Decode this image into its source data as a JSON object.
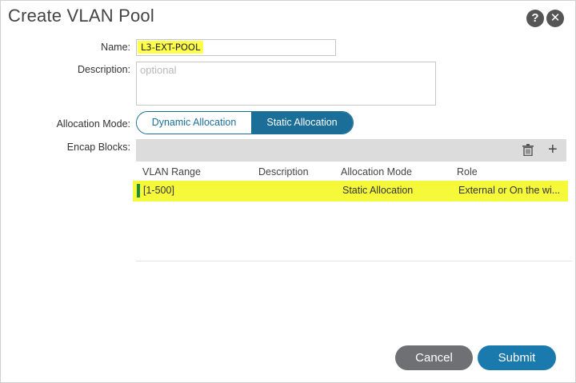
{
  "dialog": {
    "title": "Create VLAN Pool",
    "help_icon": "?",
    "close_icon": "✕"
  },
  "form": {
    "name_label": "Name:",
    "name_value": "L3-EXT-POOL",
    "description_label": "Description:",
    "description_placeholder": "optional",
    "allocation_mode_label": "Allocation Mode:",
    "allocation_options": [
      "Dynamic Allocation",
      "Static Allocation"
    ],
    "allocation_selected": "Static Allocation",
    "encap_blocks_label": "Encap Blocks:"
  },
  "encap_table": {
    "toolbar_icons": [
      "trash-icon",
      "plus-icon"
    ],
    "plus_glyph": "+",
    "columns": [
      "VLAN Range",
      "Description",
      "Allocation Mode",
      "Role"
    ],
    "rows": [
      {
        "vlan_range": "[1-500]",
        "description": "",
        "allocation_mode": "Static Allocation",
        "role": "External or On the wi..."
      }
    ]
  },
  "footer": {
    "cancel_label": "Cancel",
    "submit_label": "Submit"
  },
  "colors": {
    "accent": "#1a6e98",
    "highlight": "#fdff4a",
    "row_marker": "#1e8a3b",
    "cancel_bg": "#6e7074"
  }
}
